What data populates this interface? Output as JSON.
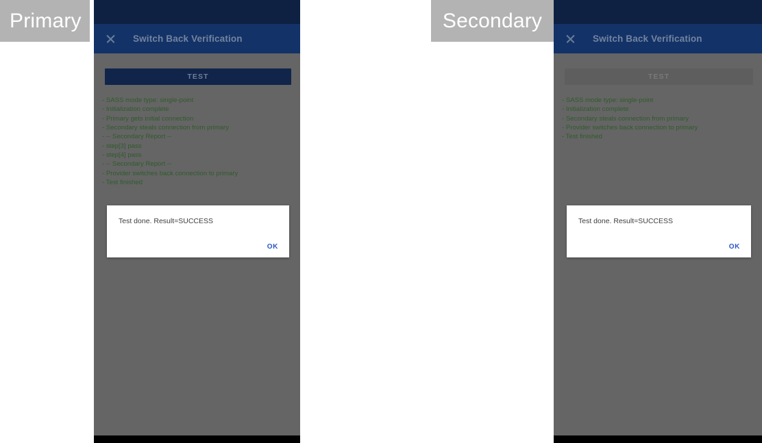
{
  "labels": {
    "primary": "Primary",
    "secondary": "Secondary"
  },
  "colors": {
    "status_bar": "#0f2142",
    "app_bar": "#133268",
    "scrim": "#656565",
    "log_text": "#2f5b2b",
    "button_enabled_bg": "#11254b",
    "button_disabled_bg": "#5e5e5e",
    "dialog_bg": "#ffffff",
    "ok_link": "#2a56c6",
    "label_chip_bg": "#b3b3b3",
    "nav_bar": "#000000"
  },
  "primary": {
    "app_bar": {
      "close_icon": "close-icon",
      "title": "Switch Back Verification"
    },
    "test_button": {
      "label": "TEST",
      "enabled": true
    },
    "log_lines": [
      "- SASS mode type: single-point",
      "- Initialization complete",
      "- Primary gets initial connection",
      "- Secondary steals connection from primary",
      "- -- Secondary Report --",
      "- step[3] pass",
      "- step[4] pass",
      "- -- Secondary Report --",
      "- Provider switches back connection to primary",
      "- Test finished"
    ],
    "dialog": {
      "message": "Test done. Result=SUCCESS",
      "ok_label": "OK"
    }
  },
  "secondary": {
    "app_bar": {
      "close_icon": "close-icon",
      "title": "Switch Back Verification"
    },
    "test_button": {
      "label": "TEST",
      "enabled": false
    },
    "log_lines": [
      "- SASS mode type: single-point",
      "- Initialization complete",
      "- Secondary steals connection from primary",
      "- Provider switches back connection to primary",
      "- Test finished"
    ],
    "dialog": {
      "message": "Test done. Result=SUCCESS",
      "ok_label": "OK"
    }
  }
}
